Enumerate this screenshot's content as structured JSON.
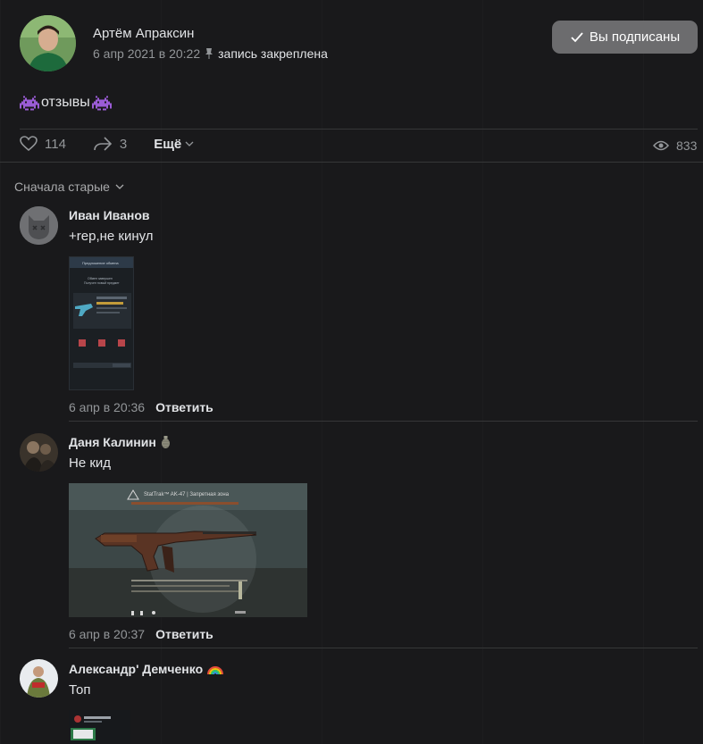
{
  "post": {
    "author": "Артём Апраксин",
    "date": "6 апр 2021 в 20:22",
    "pinned_label": "запись закреплена",
    "subscribed_label": "Вы подписаны",
    "text": "отзывы",
    "likes": "114",
    "shares": "3",
    "more_label": "Ещё",
    "views": "833"
  },
  "sort_label": "Сначала старые",
  "comments": [
    {
      "name": "Иван Иванов",
      "text": "+rep,не кинул",
      "date": "6 апр в 20:36",
      "reply": "Ответить"
    },
    {
      "name": "Даня Калинин",
      "text": "Не кид",
      "date": "6 апр в 20:37",
      "reply": "Ответить"
    },
    {
      "name": "Александр' Демченко",
      "text": "Топ"
    }
  ],
  "screenshot1": {
    "title": "Предложение обмена",
    "line1": "Обмен завершен",
    "line2": "Получен новый предмет"
  },
  "screenshot2": {
    "title": "StatTrak™ AK-47 | Запретная зона"
  },
  "colors": {
    "background": "#19191b",
    "text": "#e1e3e6",
    "muted": "#939699",
    "button": "#6c6c6e",
    "divider": "#363738"
  }
}
